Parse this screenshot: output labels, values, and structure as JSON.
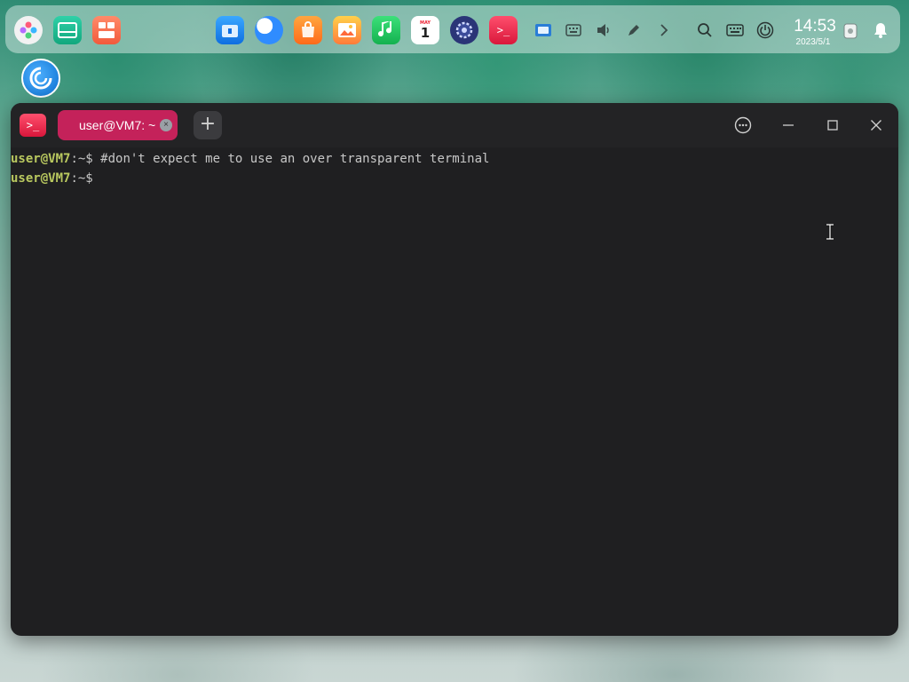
{
  "dock": {
    "apps": [
      {
        "name": "launcher",
        "icon": "launcher-icon"
      },
      {
        "name": "multitask",
        "icon": "multitask-icon"
      },
      {
        "name": "workspace",
        "icon": "workspace-icon"
      },
      {
        "name": "file-manager",
        "icon": "folder-icon"
      },
      {
        "name": "browser",
        "icon": "browser-icon"
      },
      {
        "name": "app-store",
        "icon": "app-store-icon"
      },
      {
        "name": "image-viewer",
        "icon": "image-viewer-icon"
      },
      {
        "name": "music",
        "icon": "music-icon"
      },
      {
        "name": "calendar",
        "icon": "calendar-icon",
        "day": "1"
      },
      {
        "name": "settings",
        "icon": "settings-icon"
      },
      {
        "name": "terminal",
        "icon": "terminal-icon",
        "label": ">_"
      }
    ],
    "clock": {
      "time": "14:53",
      "date": "2023/5/1"
    }
  },
  "window": {
    "app_icon_label": ">_",
    "tab_title": "user@VM7: ~",
    "new_tab_label": "+"
  },
  "terminal": {
    "lines": [
      {
        "user": "user@VM7",
        "path": ":~$ ",
        "command": "#don't expect me to use an over transparent terminal"
      },
      {
        "user": "user@VM7",
        "path": ":~$ ",
        "command": ""
      }
    ]
  },
  "colors": {
    "terminal_bg": "#1f1f21",
    "tab_active": "#c4225a",
    "prompt_user": "#b9c85f",
    "text": "#c7c7c7"
  }
}
